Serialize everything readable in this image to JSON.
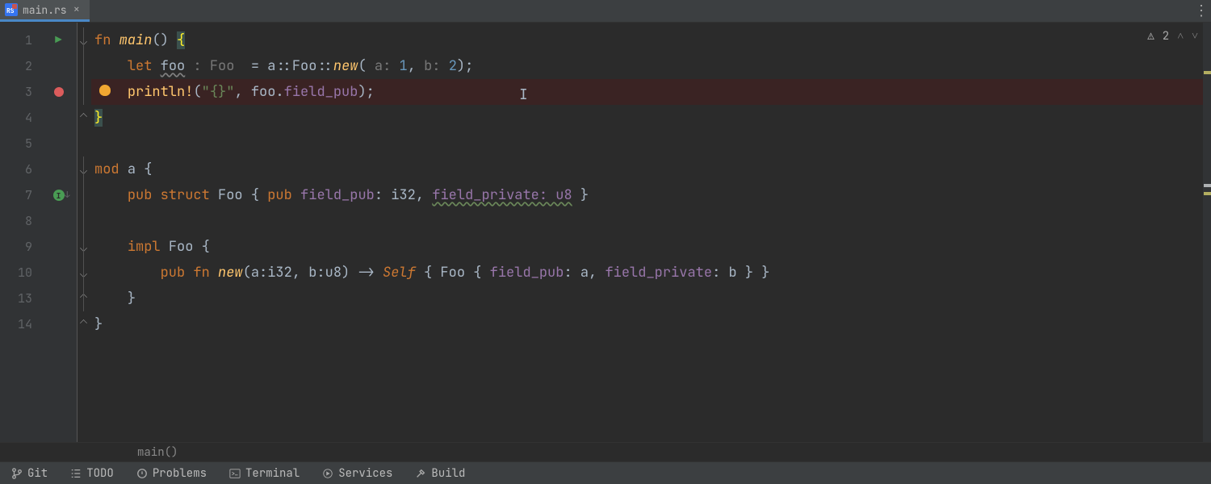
{
  "tab": {
    "filename": "main.rs",
    "icon_label": "RS"
  },
  "inspections": {
    "warn_count": "2"
  },
  "gutter": {
    "line_numbers": [
      "1",
      "2",
      "3",
      "4",
      "5",
      "6",
      "7",
      "8",
      "9",
      "10",
      "13",
      "14"
    ]
  },
  "code": {
    "l1": {
      "kw1": "fn ",
      "name": "main",
      "paren": "() ",
      "br": "{"
    },
    "l2": {
      "pad": "    ",
      "kw": "let ",
      "var": "foo",
      "hint_ty": " : Foo ",
      "eq": " = a",
      "sep": "::",
      "ty": "Foo",
      "sep2": "::",
      "new": "new",
      "op": "(",
      "h1": " a: ",
      "v1": "1",
      "c": ",",
      "h2": " b: ",
      "v2": "2",
      "cp": ");"
    },
    "l3": {
      "pad": "    ",
      "mac": "println!",
      "op": "(",
      "s": "\"{}\"",
      "c": ", foo.",
      "fld": "field_pub",
      "cp": ");"
    },
    "l4": {
      "br": "}"
    },
    "l6": {
      "kw": "mod ",
      "name": "a ",
      "br": "{"
    },
    "l7": {
      "pad": "    ",
      "kw1": "pub struct ",
      "ty": "Foo ",
      "br": "{ ",
      "kw2": "pub ",
      "f1": "field_pub",
      "t1": ": i32, ",
      "f2": "field_private: u8",
      "brc": " }"
    },
    "l9": {
      "pad": "    ",
      "kw": "impl ",
      "ty": "Foo ",
      "br": "{"
    },
    "l10": {
      "pad": "        ",
      "kw": "pub fn ",
      "name": "new",
      "sig": "(a:i32, b:u8) -> ",
      "self": "Self ",
      "br": "{ Foo { ",
      "f1": "field_pub",
      "a1": ": a, ",
      "f2": "field_private",
      "a2": ": b } ",
      "brc": "}"
    },
    "l13": {
      "pad": "    ",
      "br": "}"
    },
    "l14": {
      "br": "}"
    }
  },
  "breadcrumb": {
    "path": "main()"
  },
  "bottom": {
    "git": "Git",
    "todo": "TODO",
    "problems": "Problems",
    "terminal": "Terminal",
    "services": "Services",
    "build": "Build"
  }
}
